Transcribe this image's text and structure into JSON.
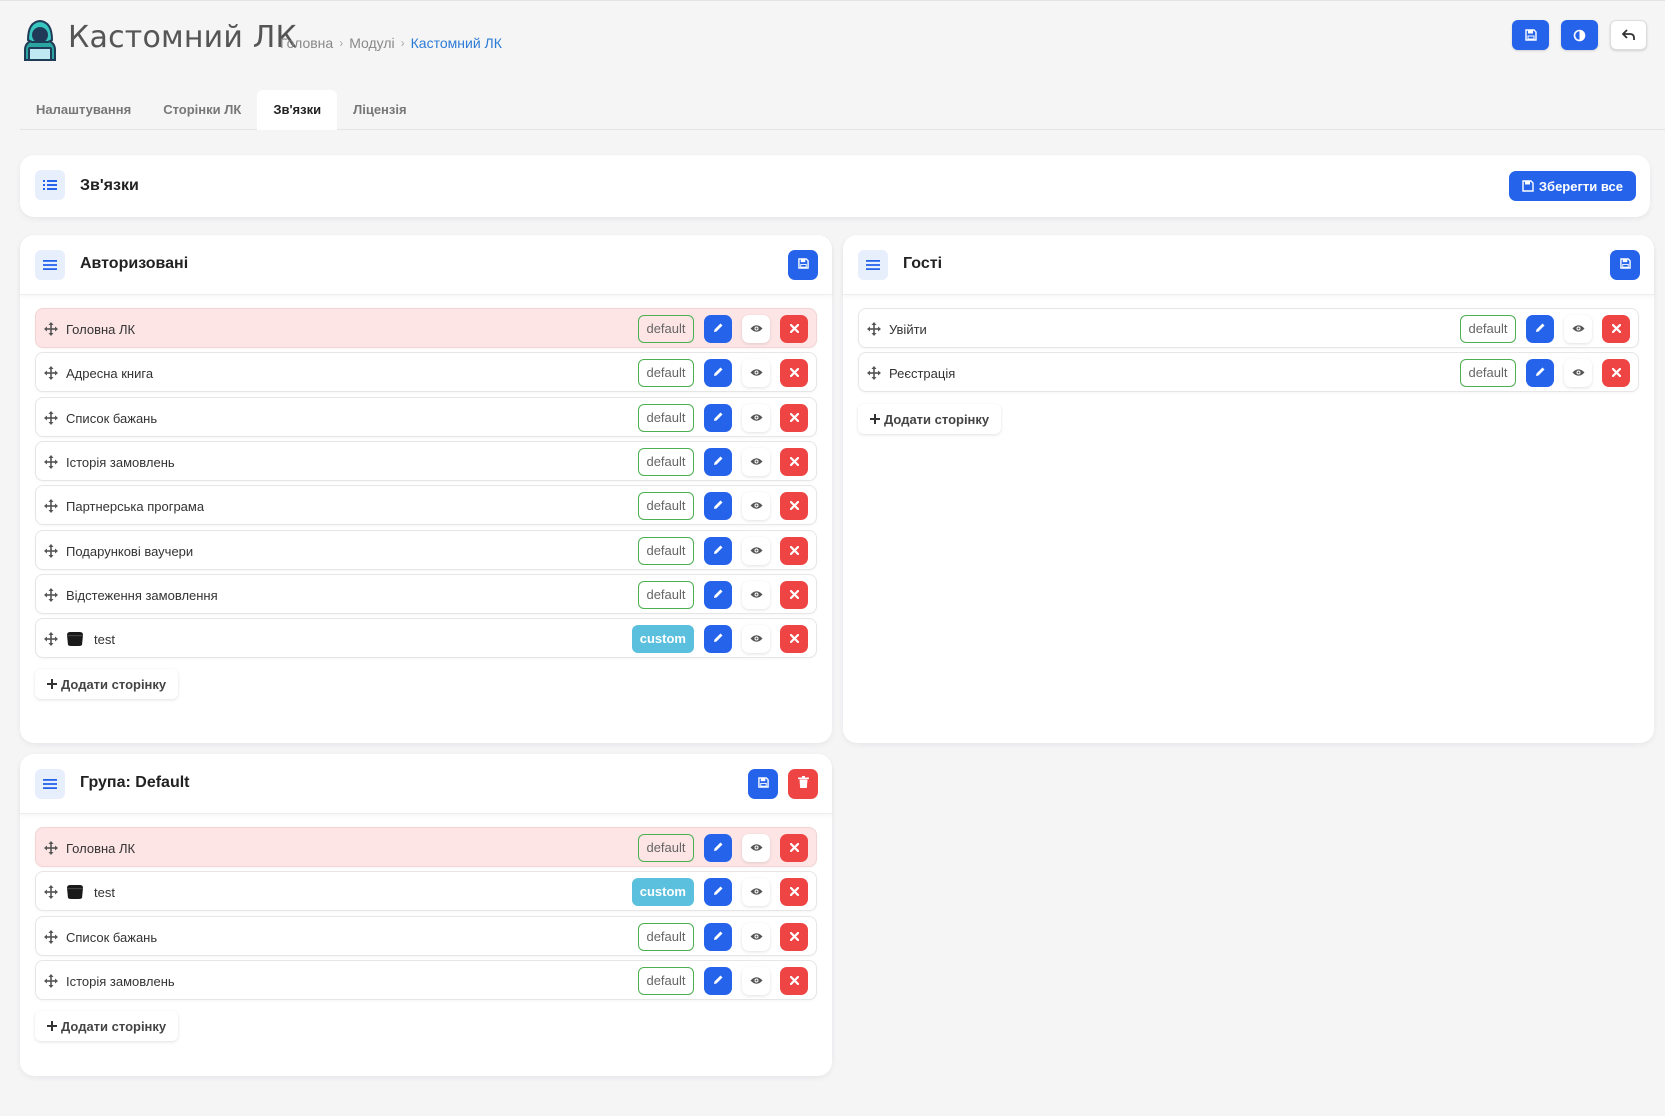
{
  "app": {
    "title": "Кастомний ЛК",
    "breadcrumb": [
      "Головна",
      "Модулі",
      "Кастомний ЛК"
    ]
  },
  "tabs": [
    {
      "label": "Налаштування",
      "active": false
    },
    {
      "label": "Сторінки ЛК",
      "active": false
    },
    {
      "label": "Зв'язки",
      "active": true
    },
    {
      "label": "Ліцензія",
      "active": false
    }
  ],
  "main_header": {
    "title": "Зв'язки",
    "save_all_label": "Зберегти все"
  },
  "panels": {
    "authorized": {
      "title": "Авторизовані",
      "add_label": "Додати сторінку",
      "rows": [
        {
          "label": "Головна ЛК",
          "badge": "default",
          "highlight": true,
          "thumb": false
        },
        {
          "label": "Адресна книга",
          "badge": "default",
          "highlight": false,
          "thumb": false
        },
        {
          "label": "Список бажань",
          "badge": "default",
          "highlight": false,
          "thumb": false
        },
        {
          "label": "Історія замовлень",
          "badge": "default",
          "highlight": false,
          "thumb": false
        },
        {
          "label": "Партнерська програма",
          "badge": "default",
          "highlight": false,
          "thumb": false
        },
        {
          "label": "Подарункові ваучери",
          "badge": "default",
          "highlight": false,
          "thumb": false
        },
        {
          "label": "Відстеження замовлення",
          "badge": "default",
          "highlight": false,
          "thumb": false
        },
        {
          "label": "test",
          "badge": "custom",
          "highlight": false,
          "thumb": true
        }
      ]
    },
    "guests": {
      "title": "Гості",
      "add_label": "Додати сторінку",
      "rows": [
        {
          "label": "Увійти",
          "badge": "default",
          "highlight": false,
          "thumb": false
        },
        {
          "label": "Реєстрація",
          "badge": "default",
          "highlight": false,
          "thumb": false
        }
      ]
    },
    "group_default": {
      "title": "Група: Default",
      "add_label": "Додати сторінку",
      "rows": [
        {
          "label": "Головна ЛК",
          "badge": "default",
          "highlight": true,
          "thumb": false
        },
        {
          "label": "test",
          "badge": "custom",
          "highlight": false,
          "thumb": true
        },
        {
          "label": "Список бажань",
          "badge": "default",
          "highlight": false,
          "thumb": false
        },
        {
          "label": "Історія замовлень",
          "badge": "default",
          "highlight": false,
          "thumb": false
        }
      ]
    }
  },
  "colors": {
    "primary": "#2563eb",
    "danger": "#ef4444",
    "info": "#5bc0de",
    "success_border": "#4caf50",
    "highlight_row": "#fde5e5"
  },
  "icons": {
    "save": "floppy-disk-icon",
    "contrast": "contrast-icon",
    "back": "undo-arrow-icon",
    "drag": "move-arrows-icon",
    "edit": "pencil-icon",
    "view": "eye-icon",
    "delete": "x-icon",
    "trash": "trash-icon",
    "list": "list-icon",
    "plus": "plus-icon"
  }
}
